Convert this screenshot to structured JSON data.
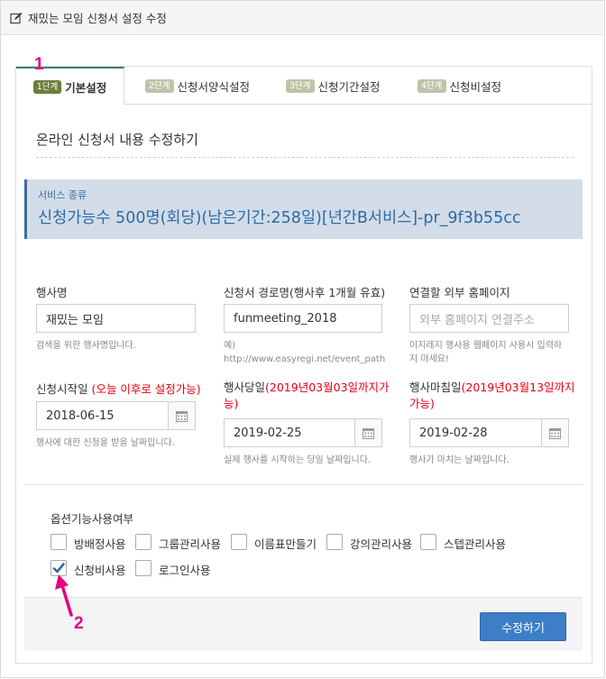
{
  "header": {
    "title": "재밌는 모임 신청서 설정 수정",
    "icon": "edit-icon"
  },
  "tabs": [
    {
      "step": "1단계",
      "label": "기본설정",
      "active": true
    },
    {
      "step": "2단계",
      "label": "신청서양식설정",
      "active": false
    },
    {
      "step": "3단계",
      "label": "신청기간설정",
      "active": false
    },
    {
      "step": "4단계",
      "label": "신청비설정",
      "active": false
    }
  ],
  "annotations": {
    "marker1": "1",
    "marker2": "2",
    "color": "#e5007e"
  },
  "section_title": "온라인 신청서 내용 수정하기",
  "service": {
    "caption": "서비스 종류",
    "value": "신청가능수 500명(회당)(남은기간:258일)[년간B서비스]-pr_9f3b55cc"
  },
  "fields": {
    "event_name": {
      "label": "행사명",
      "value": "재밌는 모임",
      "help": "검색을 위한 행사명입니다."
    },
    "path_name": {
      "label": "신청서 경로명(행사후 1개월 유효)",
      "value": "funmeeting_2018",
      "help1": "예)",
      "help2": "http://www.easyregi.net/event_path"
    },
    "homepage": {
      "label": "연결할 외부 홈페이지",
      "placeholder": "외부 홈페이지 연결주소",
      "help1": "이지레지 행사용 웹페이지 사용시 입력하",
      "help2": "지 마세요!"
    },
    "apply_start": {
      "label": "신청시작일 ",
      "label_red": "(오늘 이후로 설정가능)",
      "value": "2018-06-15",
      "help": "행사에 대한 신청을 받을 날짜입니다."
    },
    "event_day": {
      "label": "행사당일",
      "label_red1": "(2019년03월03일까지가",
      "label_red2": "능)",
      "value": "2019-02-25",
      "help": "실제 행사를 시작하는 당일 날짜입니다."
    },
    "event_end": {
      "label": "행사마침일",
      "label_red1": "(2019년03월13일까지",
      "label_red2": "가능)",
      "value": "2019-02-28",
      "help": "행사가 마치는 날짜입니다."
    }
  },
  "options": {
    "title": "옵션기능사용여부",
    "items": [
      {
        "label": "방배정사용",
        "checked": false
      },
      {
        "label": "그룹관리사용",
        "checked": false
      },
      {
        "label": "이름표만들기",
        "checked": false
      },
      {
        "label": "강의관리사용",
        "checked": false
      },
      {
        "label": "스텝관리사용",
        "checked": false
      },
      {
        "label": "신청비사용",
        "checked": true
      },
      {
        "label": "로그인사용",
        "checked": false
      }
    ]
  },
  "submit_label": "수정하기",
  "colors": {
    "accent": "#3c7fc6",
    "tab_active_border": "#3a7d7c",
    "service_bg": "#d2dde9",
    "required": "#e60012"
  }
}
